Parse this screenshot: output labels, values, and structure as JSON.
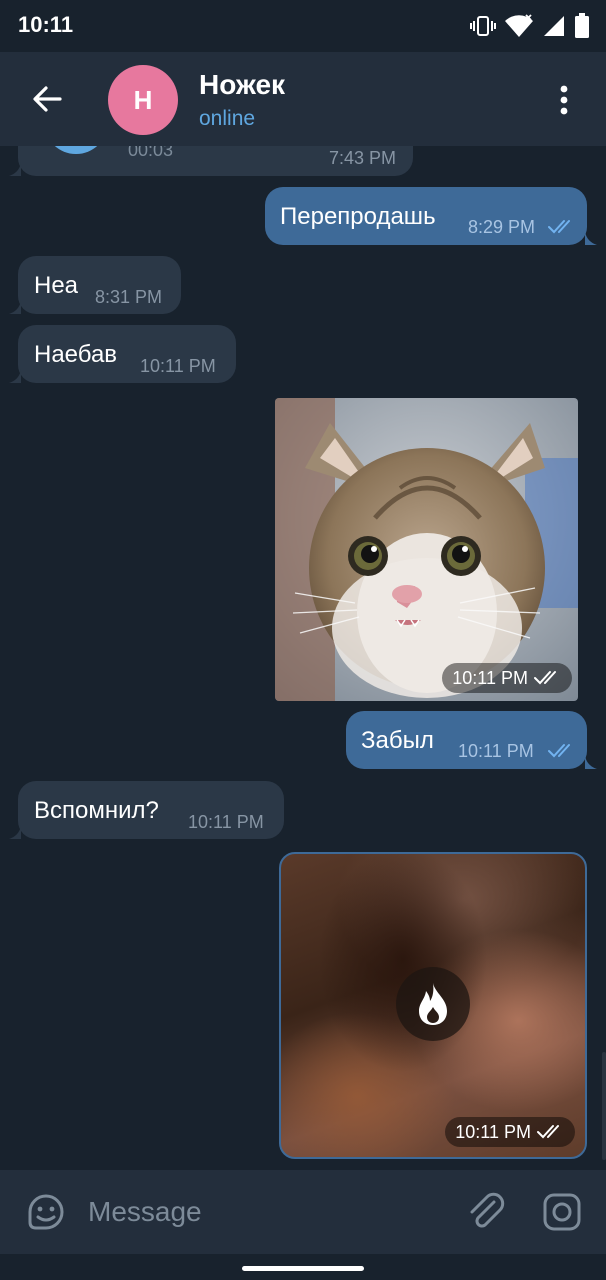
{
  "status_bar": {
    "time": "10:11"
  },
  "header": {
    "avatar_letter": "Н",
    "name": "Ножек",
    "status": "online",
    "avatar_color": "#e7789e",
    "status_color": "#5fa7e0"
  },
  "messages": [
    {
      "direction": "in",
      "text": "",
      "sub_text": "00:03",
      "time": "7:43 PM",
      "partial": true
    },
    {
      "direction": "out",
      "text": "Перепродашь",
      "time": "8:29 PM",
      "read": true
    },
    {
      "direction": "in",
      "text": "Неа",
      "time": "8:31 PM"
    },
    {
      "direction": "in",
      "text": "Наебав",
      "time": "10:11 PM"
    },
    {
      "direction": "out",
      "type": "photo",
      "time": "10:11 PM",
      "read": true,
      "icon": "cat-photo"
    },
    {
      "direction": "out",
      "text": "Забыл",
      "time": "10:11 PM",
      "read": true
    },
    {
      "direction": "in",
      "text": "Вспомнил?",
      "time": "10:11 PM"
    },
    {
      "direction": "out",
      "type": "self-destruct-media",
      "time": "10:11 PM",
      "read": true,
      "icon": "fire-icon"
    }
  ],
  "input": {
    "placeholder": "Message"
  },
  "colors": {
    "background": "#18222d",
    "header": "#232e3c",
    "incoming_bubble": "#2b3847",
    "outgoing_bubble": "#3e6a98"
  }
}
